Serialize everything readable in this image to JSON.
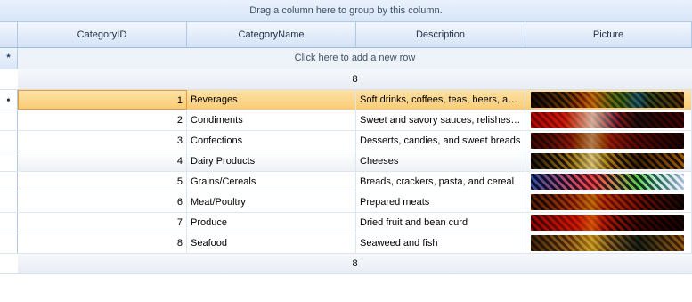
{
  "group_panel": {
    "text": "Drag a column here to group by this column."
  },
  "columns": [
    "CategoryID",
    "CategoryName",
    "Description",
    "Picture"
  ],
  "new_row": {
    "indicator": "*",
    "text": "Click here to add a new row"
  },
  "summary_top": "8",
  "summary_bottom": "8",
  "current_row_indicator": "➧",
  "rows": [
    {
      "id": "1",
      "name": "Beverages",
      "description": "Soft drinks, coffees, teas, beers, and ales"
    },
    {
      "id": "2",
      "name": "Condiments",
      "description": "Sweet and savory sauces, relishes, spreads, and seasonings"
    },
    {
      "id": "3",
      "name": "Confections",
      "description": "Desserts, candies, and sweet breads"
    },
    {
      "id": "4",
      "name": "Dairy Products",
      "description": "Cheeses"
    },
    {
      "id": "5",
      "name": "Grains/Cereals",
      "description": "Breads, crackers, pasta, and cereal"
    },
    {
      "id": "6",
      "name": "Meat/Poultry",
      "description": "Prepared meats"
    },
    {
      "id": "7",
      "name": "Produce",
      "description": "Dried fruit and bean curd"
    },
    {
      "id": "8",
      "name": "Seafood",
      "description": "Seaweed and fish"
    }
  ],
  "picture_colors": [
    [
      "#1d1409",
      "#6b4a1a",
      "#c89a3c",
      "#2e8fa3"
    ],
    [
      "#9b1b12",
      "#3a0b07",
      "#d7d2c8",
      "#1b3d5c"
    ],
    [
      "#5a1a0a",
      "#2a0c05",
      "#c8b7a2",
      "#7a3015"
    ],
    [
      "#1a1407",
      "#8c6a20",
      "#d8cdb0",
      "#3b2a10"
    ],
    [
      "#1f2f55",
      "#cfd6e4",
      "#b02a2a",
      "#3a7a2a"
    ],
    [
      "#6a3a10",
      "#1a0c05",
      "#c9a060",
      "#8a1f10"
    ],
    [
      "#8a1a10",
      "#1a0a05",
      "#d8a040",
      "#3a1a08"
    ],
    [
      "#3a2a10",
      "#8a6a30",
      "#c8b080",
      "#1a2a40"
    ]
  ]
}
